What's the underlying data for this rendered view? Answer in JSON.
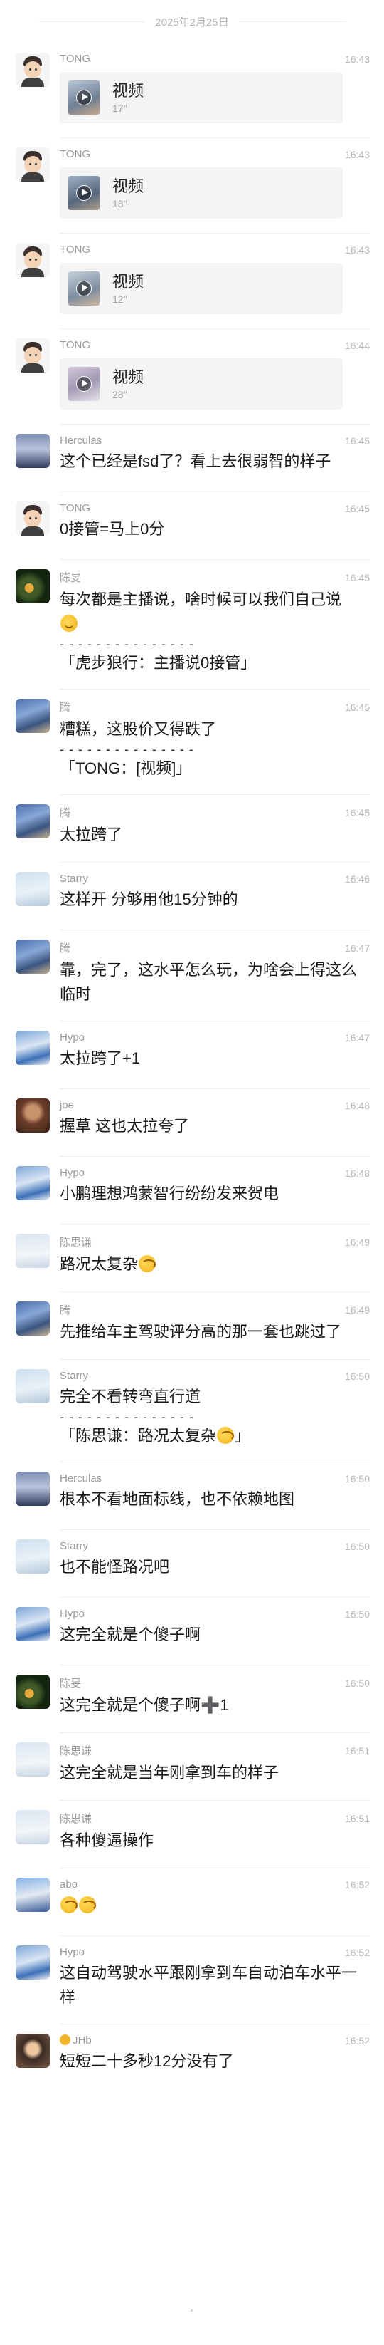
{
  "date": "2025年2月25日",
  "videos": [
    {
      "name": "TONG",
      "time": "16:43",
      "title": "视频",
      "duration": "17''"
    },
    {
      "name": "TONG",
      "time": "16:43",
      "title": "视频",
      "duration": "18''"
    },
    {
      "name": "TONG",
      "time": "16:43",
      "title": "视频",
      "duration": "12''"
    },
    {
      "name": "TONG",
      "time": "16:44",
      "title": "视频",
      "duration": "28''"
    }
  ],
  "messages": [
    {
      "name": "Herculas",
      "time": "16:45",
      "text": "这个已经是fsd了？看上去很弱智的样子"
    },
    {
      "name": "TONG",
      "time": "16:45",
      "text": "0接管=马上0分"
    },
    {
      "name": "陈旻",
      "time": "16:45",
      "text": "每次都是主播说，啥时候可以我们自己说",
      "quote": "「虎步狼行：主播说0接管」",
      "dash": "- - - - - - - - - - - - - - -"
    },
    {
      "name": "腾",
      "time": "16:45",
      "text": "糟糕，这股价又得跌了",
      "quote": "「TONG：[视频]」",
      "dash": "- - - - - - - - - - - - - - -"
    },
    {
      "name": "腾",
      "time": "16:45",
      "text": "太拉跨了"
    },
    {
      "name": "Starry",
      "time": "16:46",
      "text": "这样开 分够用他15分钟的"
    },
    {
      "name": "腾",
      "time": "16:47",
      "text": "靠，完了，这水平怎么玩，为啥会上得这么临时"
    },
    {
      "name": "Hypo",
      "time": "16:47",
      "text": "太拉跨了+1"
    },
    {
      "name": "joe",
      "time": "16:48",
      "text": "握草 这也太拉夸了"
    },
    {
      "name": "Hypo",
      "time": "16:48",
      "text": "小鹏理想鸿蒙智行纷纷发来贺电"
    },
    {
      "name": "陈思谦",
      "time": "16:49",
      "text": "路况太复杂"
    },
    {
      "name": "腾",
      "time": "16:49",
      "text": "先推给车主驾驶评分高的那一套也跳过了"
    },
    {
      "name": "Starry",
      "time": "16:50",
      "text": "完全不看转弯直行道",
      "quote": "「陈思谦：路况太复杂",
      "quote_end": "」",
      "dash": "- - - - - - - - - - - - - - -"
    },
    {
      "name": "Herculas",
      "time": "16:50",
      "text": "根本不看地面标线，也不依赖地图"
    },
    {
      "name": "Starry",
      "time": "16:50",
      "text": "也不能怪路况吧"
    },
    {
      "name": "Hypo",
      "time": "16:50",
      "text": "这完全就是个傻子啊"
    },
    {
      "name": "陈旻",
      "time": "16:50",
      "text": "这完全就是个傻子啊",
      "suffix": "1"
    },
    {
      "name": "陈思谦",
      "time": "16:51",
      "text": "这完全就是当年刚拿到车的样子"
    },
    {
      "name": "陈思谦",
      "time": "16:51",
      "text": "各种傻逼操作"
    },
    {
      "name": "abo",
      "time": "16:52",
      "text": ""
    },
    {
      "name": "Hypo",
      "time": "16:52",
      "text": "这自动驾驶水平跟刚拿到车自动泊车水平一样"
    },
    {
      "name": "JHb",
      "time": "16:52",
      "text": "短短二十多秒12分没有了"
    }
  ]
}
